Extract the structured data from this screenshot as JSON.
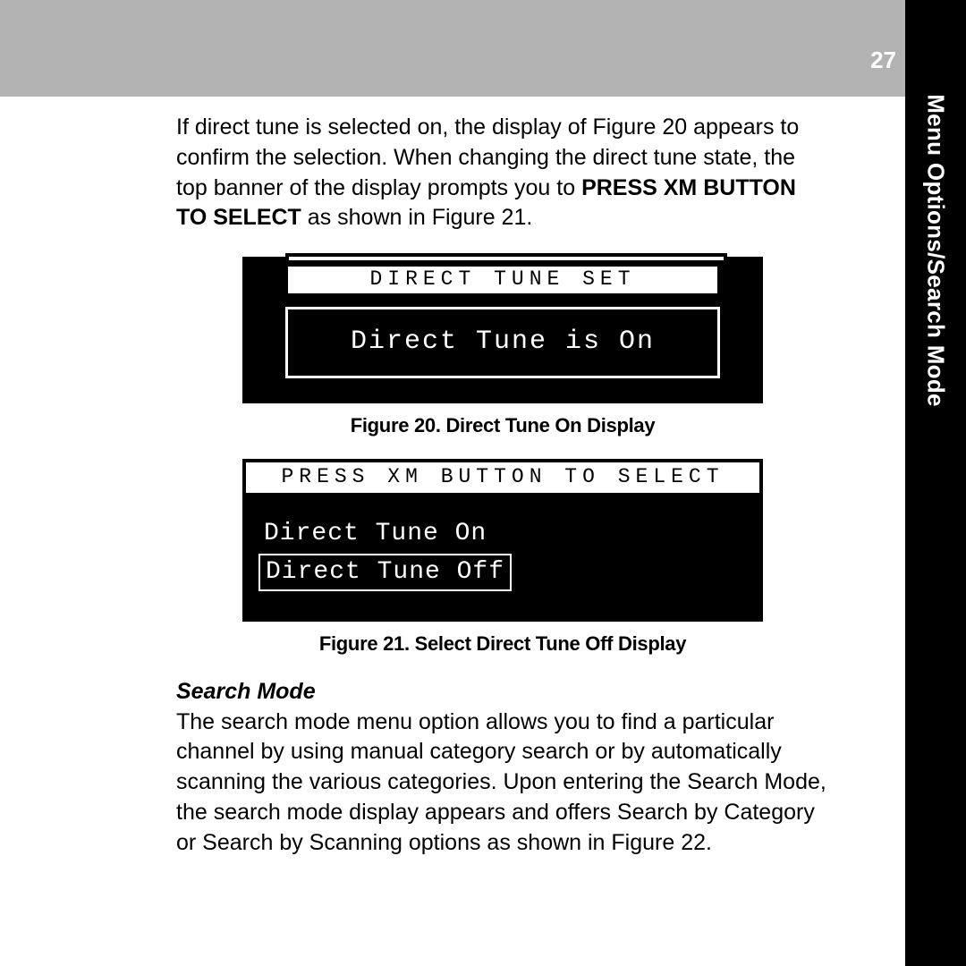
{
  "page_number": "27",
  "side_tab": "Menu Options/Search Mode",
  "para1": {
    "pre": "If direct tune is selected on, the display of Figure 20 appears to confirm the selection. When changing the direct tune state, the top banner of the display prompts you to ",
    "bold": "PRESS XM BUTTON TO SELECT",
    "post": " as shown in Figure 21."
  },
  "fig20": {
    "banner": "DIRECT TUNE SET",
    "body": "Direct Tune is On",
    "caption": "Figure 20. Direct Tune On Display"
  },
  "fig21": {
    "banner": "PRESS XM BUTTON TO SELECT",
    "option1": "Direct Tune On",
    "option2": "Direct Tune Off",
    "caption": "Figure 21. Select Direct Tune Off Display"
  },
  "section_head": "Search Mode",
  "para2": "The search mode menu option allows you to find a particular channel by  using manual category search or by automatically scanning the various categories. Upon entering the Search Mode, the search mode display appears and offers Search by Category or Search by Scanning options as shown in Figure 22."
}
